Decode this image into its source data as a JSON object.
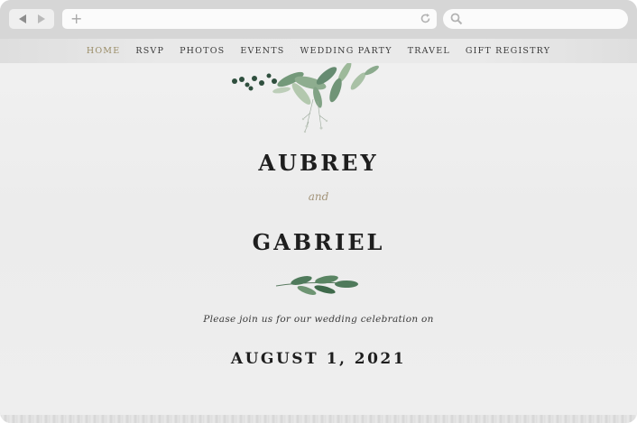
{
  "browser": {
    "back_icon": "back-arrow-icon",
    "forward_icon": "forward-arrow-icon",
    "new_tab_symbol": "+",
    "reload_icon": "reload-icon",
    "search_icon": "search-icon"
  },
  "nav": {
    "items": [
      {
        "label": "HOME",
        "active": true
      },
      {
        "label": "RSVP",
        "active": false
      },
      {
        "label": "PHOTOS",
        "active": false
      },
      {
        "label": "EVENTS",
        "active": false
      },
      {
        "label": "WEDDING PARTY",
        "active": false
      },
      {
        "label": "TRAVEL",
        "active": false
      },
      {
        "label": "GIFT REGISTRY",
        "active": false
      }
    ],
    "active_color": "#9a8c66"
  },
  "hero": {
    "name1": "AUBREY",
    "and": "and",
    "name2": "GABRIEL",
    "invite": "Please join us for our wedding celebration on",
    "date": "AUGUST 1, 2021"
  },
  "colors": {
    "accent_gold": "#a3947a",
    "text_dark": "#1e1e1e",
    "foliage_green": "#4f7a5b"
  }
}
